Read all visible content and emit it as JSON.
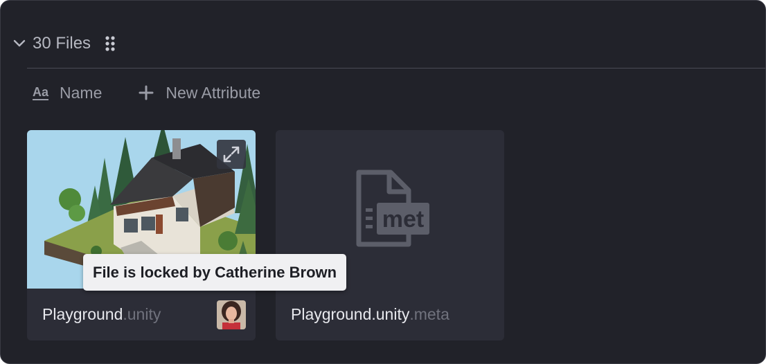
{
  "group": {
    "count_label": "30 Files"
  },
  "attributes": {
    "name_label": "Name",
    "new_attribute_label": "New Attribute"
  },
  "cards": [
    {
      "name": "Playground",
      "ext": ".unity",
      "locked": true
    },
    {
      "name": "Playground.unity",
      "ext": ".meta",
      "icon_text": "met"
    }
  ],
  "tooltip": {
    "text": "File is locked by Catherine Brown"
  },
  "colors": {
    "panel_bg": "#212229",
    "card_bg": "#2c2d37",
    "text_primary": "#e8e9ee",
    "text_muted": "#70727d",
    "tooltip_bg": "#f0f0f2"
  }
}
